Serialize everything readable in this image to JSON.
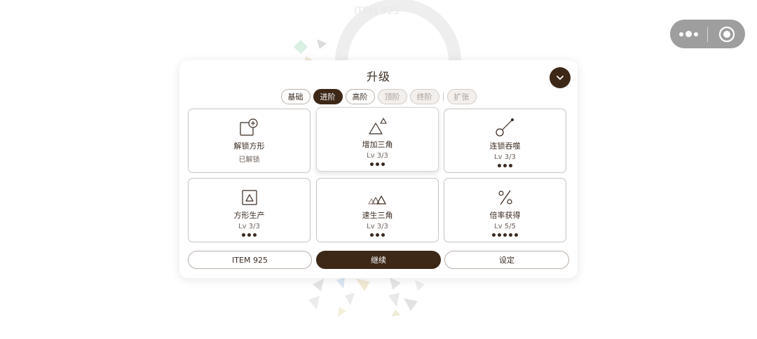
{
  "background": {
    "label": "ITEM 925"
  },
  "capsule": {
    "menu_icon": "more-dots-icon",
    "close_icon": "target-circle-icon"
  },
  "panel": {
    "title": "升级",
    "collapse_icon": "chevron-down-icon"
  },
  "tabs": [
    {
      "label": "基础",
      "state": "normal"
    },
    {
      "label": "进阶",
      "state": "active"
    },
    {
      "label": "高阶",
      "state": "normal"
    },
    {
      "label": "顶阶",
      "state": "locked"
    },
    {
      "label": "终阶",
      "state": "locked"
    },
    {
      "label": "扩张",
      "state": "locked"
    }
  ],
  "cards": [
    {
      "name": "解锁方形",
      "sub": "已解锁",
      "pips": 0,
      "icon": "square-plus-icon"
    },
    {
      "name": "增加三角",
      "sub": "Lv 3/3",
      "pips": 3,
      "icon": "triangles-icon"
    },
    {
      "name": "连锁吞噬",
      "sub": "Lv 3/3",
      "pips": 3,
      "icon": "chain-link-icon"
    },
    {
      "name": "方形生产",
      "sub": "Lv 3/3",
      "pips": 3,
      "icon": "square-triangle-icon"
    },
    {
      "name": "速生三角",
      "sub": "Lv 3/3",
      "pips": 3,
      "icon": "fast-triangles-icon"
    },
    {
      "name": "倍率获得",
      "sub": "Lv 5/5",
      "pips": 5,
      "icon": "percent-icon"
    }
  ],
  "buttons": {
    "item": "ITEM 925",
    "continue": "继续",
    "settings": "设定"
  },
  "colors": {
    "accent": "#3d2818",
    "border": "#b9afa8",
    "text": "#3a2a20"
  }
}
